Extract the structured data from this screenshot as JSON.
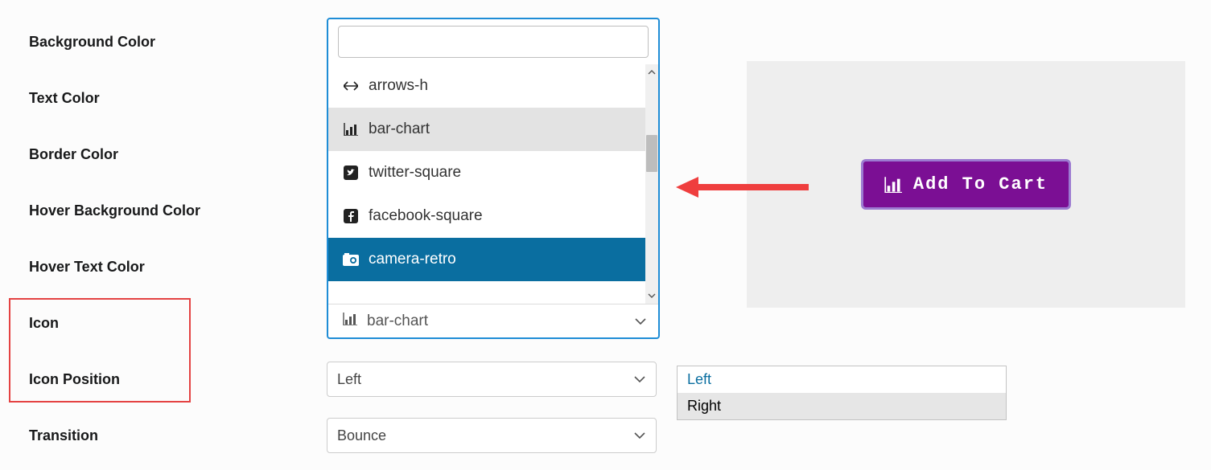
{
  "labels": {
    "bg_color": "Background Color",
    "text_color": "Text Color",
    "border_color": "Border Color",
    "hover_bg": "Hover Background Color",
    "hover_text": "Hover Text Color",
    "icon": "Icon",
    "icon_pos": "Icon Position",
    "transition": "Transition"
  },
  "selects": {
    "icon_position": "Left",
    "transition": "Bounce",
    "icon_selected_footer": "bar-chart"
  },
  "icon_dropdown": {
    "search": "",
    "options": [
      {
        "id": "arrows-h",
        "label": "arrows-h",
        "state": ""
      },
      {
        "id": "bar-chart",
        "label": "bar-chart",
        "state": "hover"
      },
      {
        "id": "twitter-square",
        "label": "twitter-square",
        "state": ""
      },
      {
        "id": "facebook-square",
        "label": "facebook-square",
        "state": ""
      },
      {
        "id": "camera-retro",
        "label": "camera-retro",
        "state": "active"
      }
    ]
  },
  "position_popup": {
    "options": [
      {
        "label": "Left",
        "state": "selected"
      },
      {
        "label": "Right",
        "state": "hov"
      }
    ]
  },
  "preview": {
    "button_label": "Add To Cart",
    "button_icon": "bar-chart",
    "bg": "#7b0f94",
    "border": "#9c7bd1",
    "text": "#ffffff"
  }
}
